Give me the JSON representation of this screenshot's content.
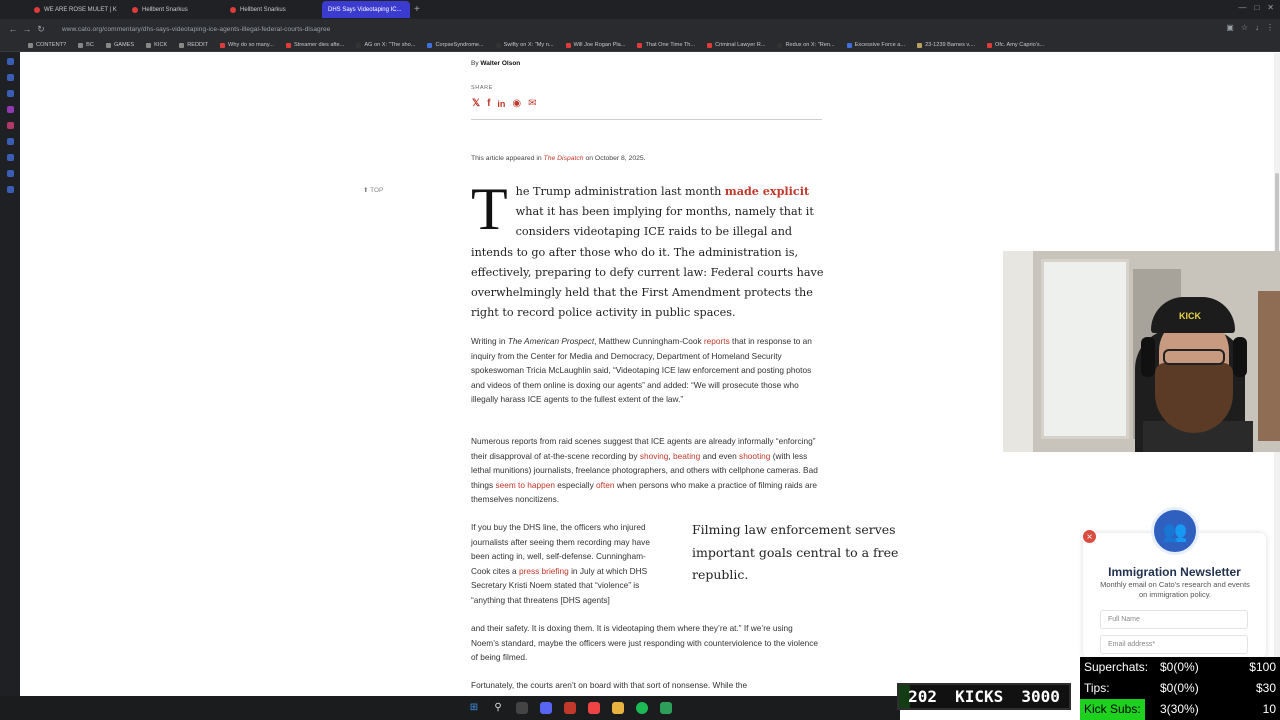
{
  "browser": {
    "tabs": [
      {
        "label": "WE ARE ROSE MULET | K"
      },
      {
        "label": "Hellbent Snarkus"
      },
      {
        "label": "Hellbent Snarkus"
      },
      {
        "label": "DHS Says Videotaping IC..."
      }
    ],
    "new_tab_symbol": "+",
    "url": "www.cato.org/commentary/dhs-says-videotaping-ice-agents-illegal-federal-courts-disagree",
    "bookmarks": [
      "CONTENT?",
      "BC",
      "GAMES",
      "KICK",
      "REDDIT",
      "Why do so many...",
      "Streamer dies afte...",
      "AG on X: \"The sho...",
      "CorpseSyndrome...",
      "Swifty on X: \"My n...",
      "Will Joe Rogan Pla...",
      "That One Time Th...",
      "Criminal Lawyer R...",
      "Redux on X: \"Ren...",
      "Excessive Force a...",
      "23-1239 Barnes v....",
      "Ofc. Amy Caprio's..."
    ]
  },
  "article": {
    "byline_prefix": "By",
    "author": "Walter Olson",
    "share_label": "SHARE",
    "appeared_prefix": "This article appeared in",
    "appeared_source": "The Dispatch",
    "appeared_suffix": "on October 8, 2025.",
    "top_link": "TOP",
    "lead_dropcap": "T",
    "lead_start": "he Trump administration last month",
    "lead_link": "made explicit",
    "lead_rest": "what it has been implying for months, namely that it considers videotaping ICE raids to be illegal and intends to go after those who do it. The administration is, effectively, preparing to defy current law: Federal courts have overwhelmingly held that the First Amendment protects the right to record police activity in public spaces.",
    "p2_a": "Writing in",
    "p2_pub": "The American Prospect",
    "p2_b": ", Matthew Cunningham-Cook",
    "p2_link": "reports",
    "p2_c": "that in response to an inquiry from the Center for Media and Democracy, Department of Homeland Security spokeswoman Tricia McLaughlin said, “Videotaping ICE law enforcement and posting photos and videos of them online is doxing our agents” and added: “We will prosecute those who illegally harass ICE agents to the fullest extent of the law.”",
    "p3_a": "Numerous reports from raid scenes suggest that ICE agents are already informally “enforcing” their disapproval of at-the-scene recording by",
    "p3_l1": "shoving",
    "p3_sep": ",",
    "p3_l2": "beating",
    "p3_b": "and even",
    "p3_l3": "shooting",
    "p3_c": "(with less lethal munitions) journalists, freelance photographers, and others with cellphone cameras. Bad things",
    "p3_l4": "seem to happen",
    "p3_d": "especially",
    "p3_l5": "often",
    "p3_e": "when persons who make a practice of filming raids are themselves noncitizens.",
    "p4_a": "If you buy the DHS line, the officers who injured journalists after seeing them recording may have been acting in, well, self-defense. Cunningham-Cook cites a",
    "p4_link": "press briefing",
    "p4_b": "in July at which DHS Secretary Kristi Noem stated that “violence” is “anything that threatens [DHS agents]",
    "p5": "and their safety. It is doxing them. It is videotaping them where they’re at.” If we’re using Noem’s standard, maybe the officers were just responding with counterviolence to the violence of being filmed.",
    "p6": "Fortunately, the courts aren’t on board with that sort of nonsense. While the",
    "pullquote": "Filming law enforcement serves important goals central to a free republic."
  },
  "newsletter": {
    "close_symbol": "×",
    "title": "Immigration Newsletter",
    "description": "Monthly email on Cato's research and events on immigration policy.",
    "name_placeholder": "Full Name",
    "email_placeholder": "Email address*"
  },
  "webcam": {
    "cap_text": "KICK"
  },
  "overlay": {
    "kicks_count": "202",
    "kicks_label": "KICKS",
    "kicks_goal": "3000",
    "kicks_progress": 0.067,
    "stats": [
      {
        "label": "Superchats:",
        "value": "$0(0%)",
        "goal": "$100"
      },
      {
        "label": "Tips:",
        "value": "$0(0%)",
        "goal": "$30"
      },
      {
        "label": "Kick Subs:",
        "value": "3(30%)",
        "goal": "10"
      }
    ]
  },
  "colors": {
    "accent_red": "#c0392b",
    "active_tab": "#3b3ccf",
    "kick_green": "#1fd11f",
    "newsletter_blue": "#2f5fbf"
  },
  "icons": [
    "x-icon",
    "facebook-icon",
    "linkedin-icon",
    "reddit-icon",
    "email-icon",
    "newsletter-people-icon"
  ]
}
